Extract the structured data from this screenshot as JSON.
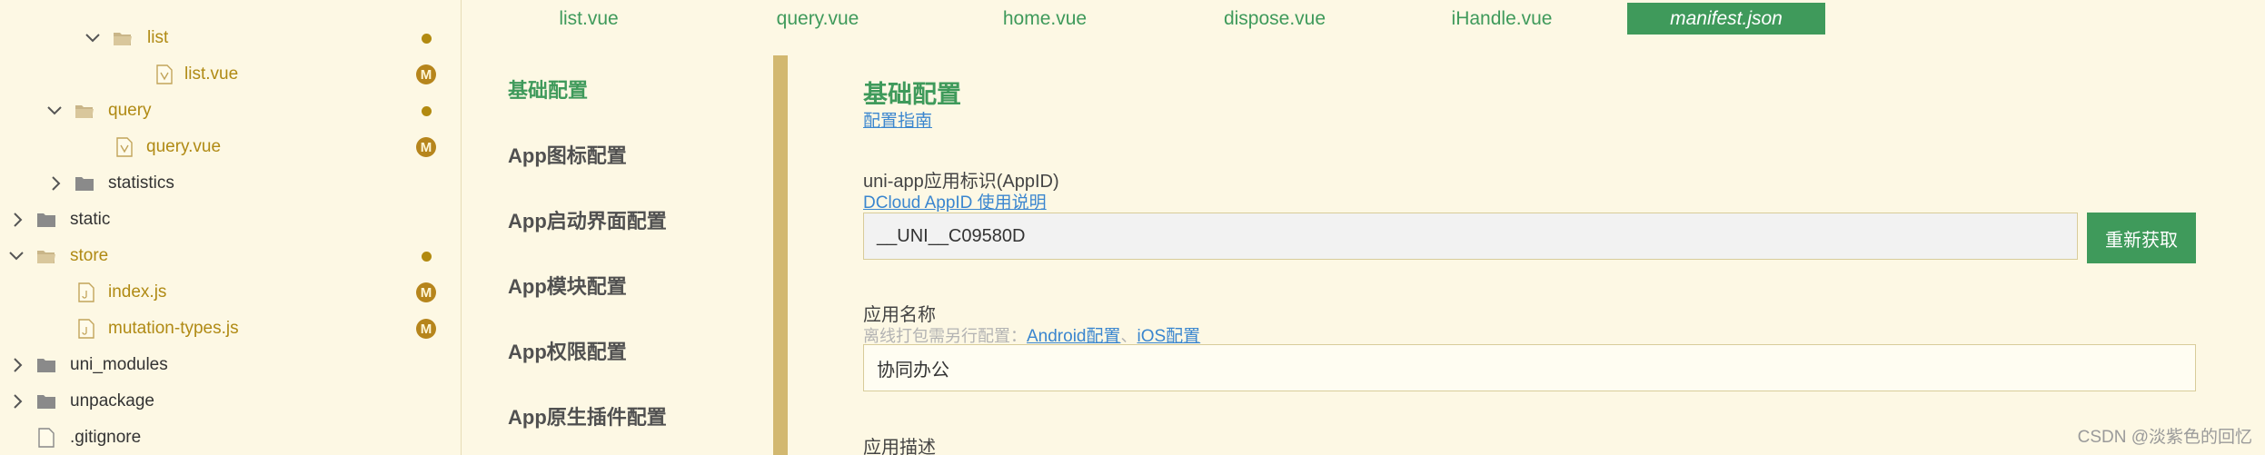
{
  "explorer": {
    "items": [
      {
        "name": "list",
        "type": "folder",
        "expanded": true,
        "status": "dot",
        "color": "mod"
      },
      {
        "name": "list.vue",
        "type": "vue",
        "status": "M",
        "color": "mod"
      },
      {
        "name": "query",
        "type": "folder",
        "expanded": true,
        "status": "dot",
        "color": "mod"
      },
      {
        "name": "query.vue",
        "type": "vue",
        "status": "M",
        "color": "mod"
      },
      {
        "name": "statistics",
        "type": "folder",
        "expanded": false,
        "status": "",
        "color": "plain"
      },
      {
        "name": "static",
        "type": "folder",
        "expanded": false,
        "status": "",
        "color": "plain"
      },
      {
        "name": "store",
        "type": "folder",
        "expanded": true,
        "status": "dot",
        "color": "mod"
      },
      {
        "name": "index.js",
        "type": "js",
        "status": "M",
        "color": "mod"
      },
      {
        "name": "mutation-types.js",
        "type": "js",
        "status": "M",
        "color": "mod"
      },
      {
        "name": "uni_modules",
        "type": "folder",
        "expanded": false,
        "status": "",
        "color": "plain"
      },
      {
        "name": "unpackage",
        "type": "folder",
        "expanded": false,
        "status": "",
        "color": "plain"
      },
      {
        "name": ".gitignore",
        "type": "file",
        "status": "",
        "color": "plain"
      }
    ]
  },
  "tabs": [
    {
      "label": "list.vue",
      "active": false
    },
    {
      "label": "query.vue",
      "active": false
    },
    {
      "label": "home.vue",
      "active": false
    },
    {
      "label": "dispose.vue",
      "active": false
    },
    {
      "label": "iHandle.vue",
      "active": false
    },
    {
      "label": "manifest.json",
      "active": true
    }
  ],
  "config_nav": [
    {
      "label": "基础配置",
      "active": true
    },
    {
      "label": "App图标配置",
      "active": false
    },
    {
      "label": "App启动界面配置",
      "active": false
    },
    {
      "label": "App模块配置",
      "active": false
    },
    {
      "label": "App权限配置",
      "active": false
    },
    {
      "label": "App原生插件配置",
      "active": false
    }
  ],
  "main": {
    "section_title": "基础配置",
    "guide_link": "配置指南",
    "appid": {
      "label": "uni-app应用标识(AppID)",
      "help_link": "DCloud AppID 使用说明",
      "value": "__UNI__C09580D",
      "button": "重新获取"
    },
    "appname": {
      "label": "应用名称",
      "hint": "离线打包需另行配置：",
      "android_link": "Android配置",
      "separator": "、",
      "ios_link": "iOS配置",
      "value": "协同办公"
    },
    "appdesc": {
      "label": "应用描述"
    }
  },
  "watermark": "CSDN @淡紫色的回忆",
  "colors": {
    "background": "#fdf8e4",
    "accent_green": "#3f9a5b",
    "modified_gold": "#b08a14",
    "link_blue": "#3a86cf",
    "divider": "#d2b870"
  }
}
